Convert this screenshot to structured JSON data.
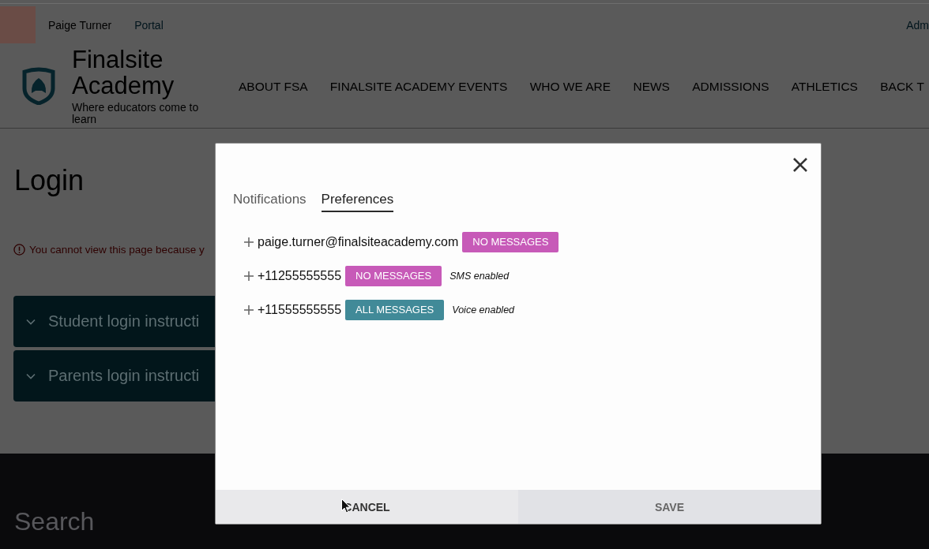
{
  "top_bar": {
    "user_name": "Paige Turner",
    "portal_link": "Portal",
    "admin_link": "Adm"
  },
  "site": {
    "name": "Finalsite Academy",
    "tagline": "Where educators come to learn"
  },
  "nav": [
    "ABOUT FSA",
    "FINALSITE ACADEMY EVENTS",
    "WHO WE ARE",
    "NEWS",
    "ADMISSIONS",
    "ATHLETICS",
    "BACK T"
  ],
  "page": {
    "title": "Login",
    "error": "You cannot view this page because y",
    "accordions": [
      {
        "label": "Student login instructi",
        "expanded": false
      },
      {
        "label": "Parents login instructi",
        "expanded": false
      }
    ]
  },
  "footer": {
    "heading": "Search"
  },
  "dialog": {
    "tabs": [
      {
        "label": "Notifications",
        "selected": false
      },
      {
        "label": "Preferences",
        "selected": true
      }
    ],
    "contacts": [
      {
        "address": "paige.turner@finalsiteacademy.com",
        "status": {
          "label": "NO MESSAGES",
          "color": "#c75ab8"
        }
      },
      {
        "address": "+11255555555",
        "status": {
          "label": "NO MESSAGES",
          "color": "#c75ab8"
        },
        "note": "SMS enabled"
      },
      {
        "address": "+11555555555",
        "status": {
          "label": "ALL MESSAGES",
          "color": "#418a98"
        },
        "note": "Voice enabled"
      }
    ],
    "buttons": [
      {
        "label": "CANCEL",
        "kind": "cancel"
      },
      {
        "label": "SAVE",
        "kind": "save"
      }
    ]
  }
}
